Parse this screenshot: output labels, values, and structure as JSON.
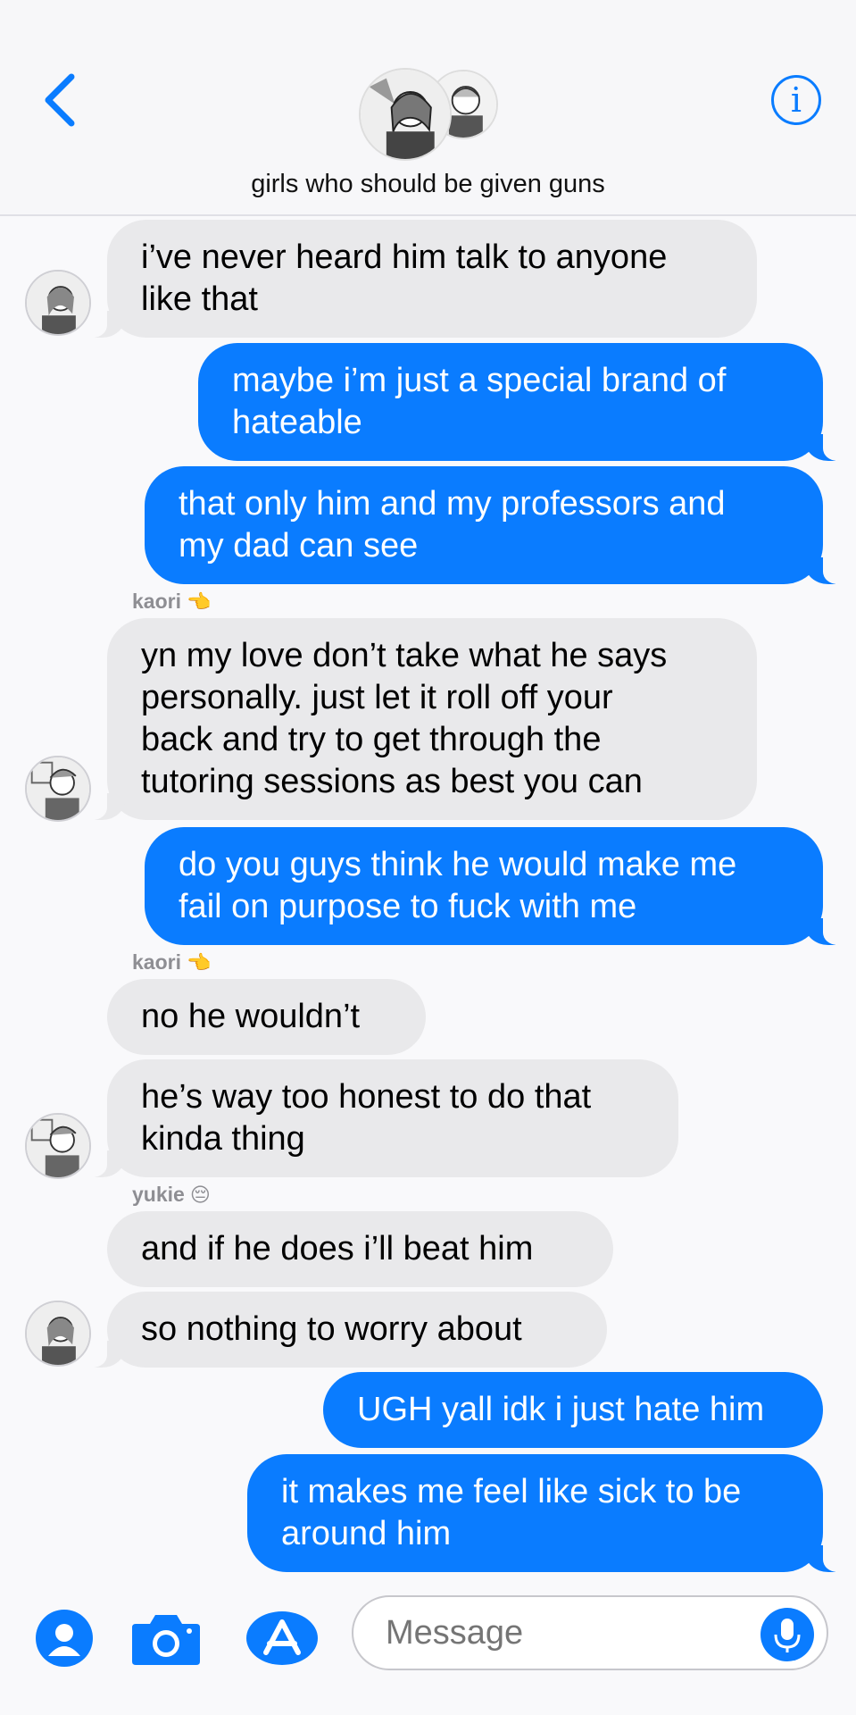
{
  "header": {
    "title": "girls who should be given guns",
    "info_glyph": "i"
  },
  "messages": [
    {
      "dir": "in",
      "text": "i’ve never heard him talk to anyone\nlike that"
    },
    {
      "dir": "out",
      "text": "maybe i’m just a special brand of\nhateable"
    },
    {
      "dir": "out",
      "text": "that only him and my professors and\nmy dad can see"
    },
    {
      "sender": "kaori",
      "sender_emoji": "👈"
    },
    {
      "dir": "in",
      "text": "yn my love don’t take what he says\npersonally. just let it roll off your\nback and try to get through the\ntutoring sessions as best you can"
    },
    {
      "dir": "out",
      "text": "do you guys think he would make me\nfail on purpose to fuck with me"
    },
    {
      "sender": "kaori",
      "sender_emoji": "👈"
    },
    {
      "dir": "in",
      "text": "no he wouldn’t"
    },
    {
      "dir": "in",
      "text": "he’s way too honest to do that\nkinda thing"
    },
    {
      "sender": "yukie",
      "sender_emoji": "😔"
    },
    {
      "dir": "in",
      "text": "and if he does i’ll beat him"
    },
    {
      "dir": "in",
      "text": "so nothing to worry about"
    },
    {
      "dir": "out",
      "text": "UGH yall idk i just hate him"
    },
    {
      "dir": "out",
      "text": "it makes me feel like sick to be\naround him"
    }
  ],
  "composer": {
    "placeholder": "Message"
  },
  "icons": {
    "back": "chevron-left-icon",
    "info": "info-icon",
    "contact": "contact-icon",
    "camera": "camera-icon",
    "app_store": "app-store-icon",
    "mic": "microphone-icon"
  },
  "colors": {
    "accent": "#0a7cff",
    "incoming": "#e9e9eb",
    "outgoing": "#0a7cff",
    "sender_label": "#8e8e93"
  }
}
